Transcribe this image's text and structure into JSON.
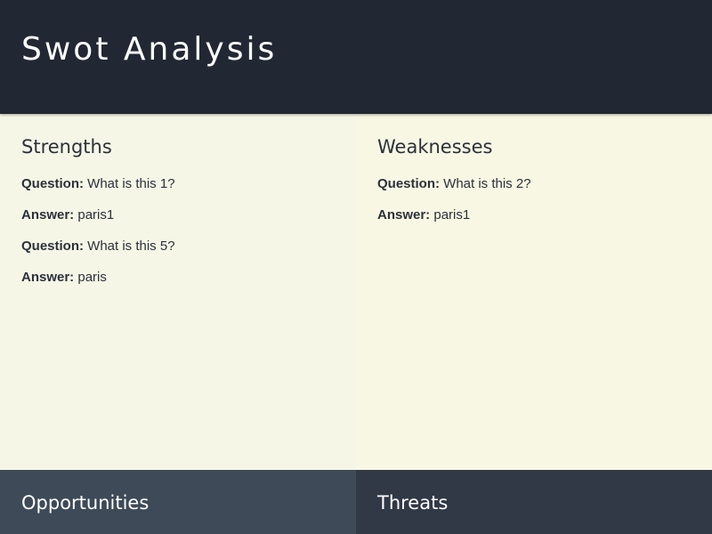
{
  "header": {
    "title": "Swot Analysis"
  },
  "colors": {
    "header_bg": "#212833",
    "strengths_bg": "#f6f6e6",
    "weaknesses_bg": "#f8f7e3",
    "opportunities_bg": "#3e4a58",
    "threats_bg": "#313846",
    "text_dark": "#2b313b"
  },
  "quadrants": {
    "strengths": {
      "title": "Strengths",
      "items": [
        {
          "question_label": "Question:",
          "question": " What is this 1?",
          "answer_label": "Answer:",
          "answer": " paris1"
        },
        {
          "question_label": "Question:",
          "question": " What is this 5?",
          "answer_label": "Answer:",
          "answer": " paris"
        }
      ]
    },
    "weaknesses": {
      "title": "Weaknesses",
      "items": [
        {
          "question_label": "Question:",
          "question": " What is this 2?",
          "answer_label": "Answer:",
          "answer": " paris1"
        }
      ]
    },
    "opportunities": {
      "title": "Opportunities",
      "items": []
    },
    "threats": {
      "title": "Threats",
      "items": []
    }
  }
}
